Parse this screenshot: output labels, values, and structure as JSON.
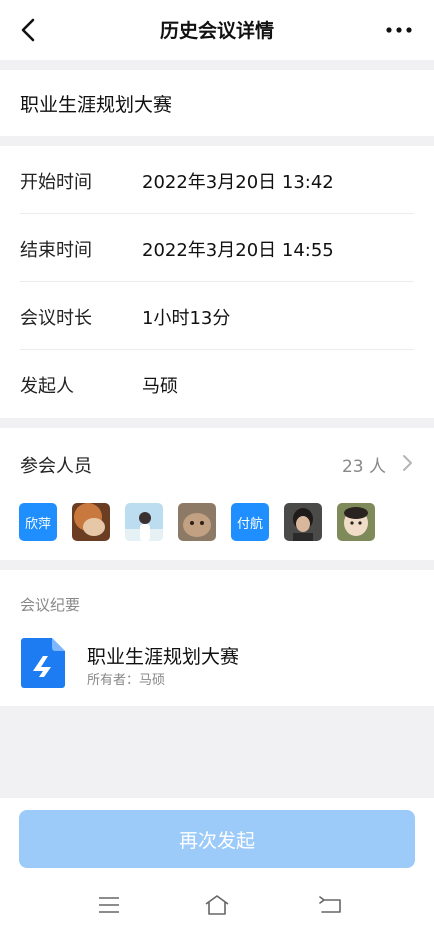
{
  "nav": {
    "title": "历史会议详情",
    "back_icon": "chevron-left-icon",
    "more_icon": "more-horizontal-icon"
  },
  "meeting": {
    "name": "职业生涯规划大赛"
  },
  "info": [
    {
      "label": "开始时间",
      "value": "2022年3月20日  13:42"
    },
    {
      "label": "结束时间",
      "value": "2022年3月20日  14:55"
    },
    {
      "label": "会议时长",
      "value": "1小时13分"
    },
    {
      "label": "发起人",
      "value": "马硕"
    }
  ],
  "attendees": {
    "label": "参会人员",
    "count": "23 人",
    "avatars": [
      {
        "type": "text",
        "text": "欣萍"
      },
      {
        "type": "image",
        "icon": "photo-avatar"
      },
      {
        "type": "image",
        "icon": "photo-avatar"
      },
      {
        "type": "image",
        "icon": "photo-avatar"
      },
      {
        "type": "text",
        "text": "付航"
      },
      {
        "type": "image",
        "icon": "photo-avatar"
      },
      {
        "type": "image",
        "icon": "photo-avatar"
      }
    ]
  },
  "summary": {
    "label": "会议纪要",
    "doc_title": "职业生涯规划大赛",
    "doc_owner": "所有者：马硕",
    "doc_icon": "document-icon"
  },
  "action": {
    "restart_label": "再次发起"
  },
  "colors": {
    "accent": "#1f8fff",
    "button_disabled": "#9ccbf9",
    "page_bg": "#f1f1f3"
  }
}
